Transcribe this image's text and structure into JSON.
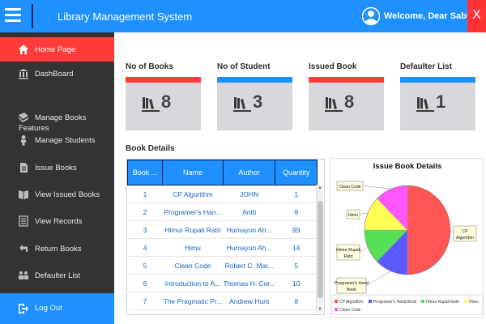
{
  "header": {
    "title": "Library Management System",
    "welcome": "Welcome, Dear Sabbir",
    "close_label": "X",
    "color": "#1e90ff"
  },
  "sidebar": {
    "items": [
      {
        "label": "Home Page",
        "icon": "home-icon",
        "active": true
      },
      {
        "label": "DashBoard",
        "icon": "bank-icon",
        "active": false
      }
    ],
    "section": "Features",
    "features": [
      {
        "label": "Manage Books",
        "icon": "book-icon"
      },
      {
        "label": "Manage Students",
        "icon": "user-icon"
      },
      {
        "label": "Issue Books",
        "icon": "file-icon"
      },
      {
        "label": "View Issued Books",
        "icon": "book-open-icon"
      },
      {
        "label": "View Records",
        "icon": "list-icon"
      },
      {
        "label": "Return Books",
        "icon": "return-icon"
      },
      {
        "label": "Defaulter List",
        "icon": "group-icon"
      }
    ],
    "logout": "Log Out"
  },
  "cards": [
    {
      "label": "No of Books",
      "value": "8",
      "bar_color": "#ff3b3b"
    },
    {
      "label": "No of Student",
      "value": "3",
      "bar_color": "#1e90ff"
    },
    {
      "label": "Issued Book",
      "value": "8",
      "bar_color": "#ff3b3b"
    },
    {
      "label": "Defaulter List",
      "value": "1",
      "bar_color": "#1e90ff"
    }
  ],
  "book_details": {
    "title": "Book Details",
    "columns": [
      "Book ...",
      "Name",
      "Author",
      "Quantity"
    ],
    "rows": [
      [
        "1",
        "CP Algorithm",
        "JOHN",
        "1"
      ],
      [
        "2",
        "Programer's Han...",
        "Antti",
        "9"
      ],
      [
        "3",
        "Himur Rupali Ratri",
        "Humayun Ah...",
        "99"
      ],
      [
        "4",
        "Himu",
        "Humayun Ah...",
        "14"
      ],
      [
        "5",
        "Clean Code",
        "Robert C. Mar...",
        "5"
      ],
      [
        "6",
        "Introduction to A...",
        "Thomas H. Cor...",
        "10"
      ],
      [
        "7",
        "The Pragmatic Pr...",
        "Andrew Hunt",
        "8"
      ]
    ]
  },
  "chart_data": {
    "type": "pie",
    "title": "Issue Book Details",
    "categories": [
      "CP Algorithm",
      "Programer's Hand Book",
      "Himur Rupali Ratri",
      "Himu",
      "Clean Code"
    ],
    "values": [
      50,
      12.5,
      12.5,
      12.5,
      12.5
    ],
    "colors": [
      "#ff5555",
      "#5a5aff",
      "#55e055",
      "#ffff55",
      "#ff55ff"
    ],
    "data_labels": [
      "CP Algorithm",
      "Programer's Hand Book",
      "Himur Rupali Ratri",
      "Himu",
      "Clean Code"
    ],
    "legend": [
      "CP Algorithm",
      "Programer's Hand Book",
      "Himur Rupali Ratri",
      "Himu",
      "Clean Code"
    ],
    "legend_position": "bottom"
  }
}
